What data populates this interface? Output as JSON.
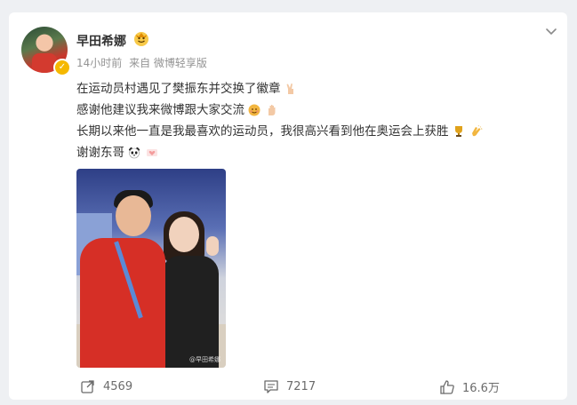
{
  "post": {
    "author": "早田希娜",
    "time": "14小时前",
    "source": "来自 微博轻享版",
    "lines": [
      "在运动员村遇见了樊振东并交换了徽章",
      "感谢他建议我来微博跟大家交流",
      "长期以来他一直是我最喜欢的运动员，我很高兴看到他在奥运会上获胜",
      "谢谢东哥"
    ],
    "watermark": "@早田希娜"
  },
  "actions": {
    "repost_count": "4569",
    "comment_count": "7217",
    "like_count": "16.6万"
  },
  "icons": {
    "line1": [
      "victory-hand-icon"
    ],
    "line2": [
      "smiling-face-icon",
      "raised-hand-icon"
    ],
    "line3": [
      "trophy-icon",
      "clapping-hands-icon"
    ],
    "line4": [
      "panda-icon",
      "hearts-icon"
    ]
  }
}
